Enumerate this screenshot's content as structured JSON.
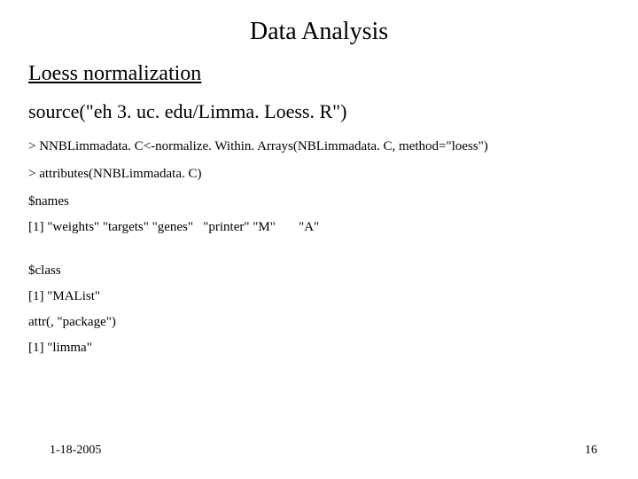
{
  "title": "Data Analysis",
  "subtitle": "Loess normalization",
  "source_line": "source(\"eh 3. uc. edu/Limma. Loess. R\")",
  "code": {
    "line1": "> NNBLimmadata. C<-normalize. Within. Arrays(NBLimmadata. C, method=\"loess\")",
    "line2": "> attributes(NNBLimmadata. C)"
  },
  "output": {
    "names_label": "$names",
    "names_values": "[1] \"weights\" \"targets\" \"genes\"   \"printer\" \"M\"       \"A\"",
    "class_label": "$class",
    "class_value": "[1] \"MAList\"",
    "attr_line": "attr(, \"package\")",
    "package_value": "[1] \"limma\""
  },
  "footer": {
    "date": "1-18-2005",
    "page": "16"
  }
}
